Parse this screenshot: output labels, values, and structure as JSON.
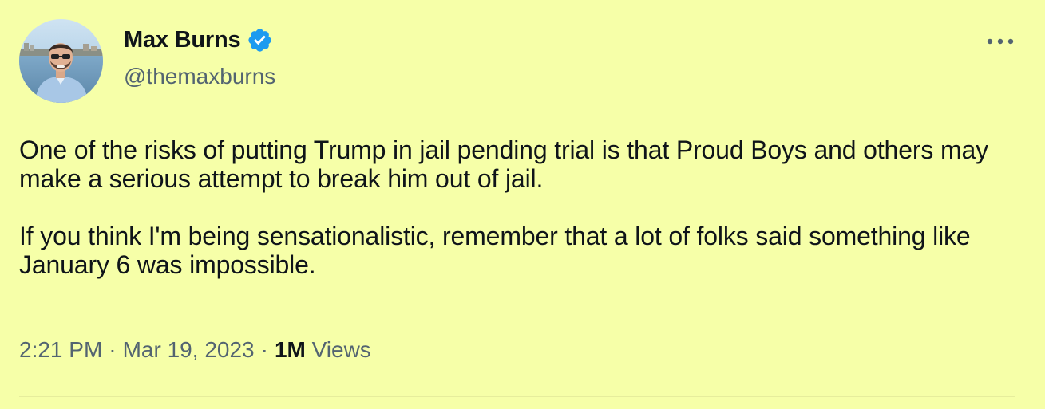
{
  "author": {
    "display_name": "Max Burns",
    "handle": "@themaxburns",
    "verified": true,
    "verified_color": "#1d9bf0"
  },
  "tweet": {
    "paragraphs": [
      "One of the risks of putting Trump in jail pending trial is that Proud Boys and others may make a serious attempt to break him out of jail.",
      "If you think I'm being sensationalistic, remember that a lot of folks said something like January 6 was impossible."
    ]
  },
  "meta": {
    "time": "2:21 PM",
    "separator": "·",
    "date": "Mar 19, 2023",
    "views_count": "1M",
    "views_label": "Views"
  },
  "icons": {
    "more": "more-horizontal-icon",
    "verified": "verified-badge-icon"
  },
  "colors": {
    "background": "#f6ffa8",
    "text": "#0f1419",
    "secondary_text": "#536471"
  }
}
